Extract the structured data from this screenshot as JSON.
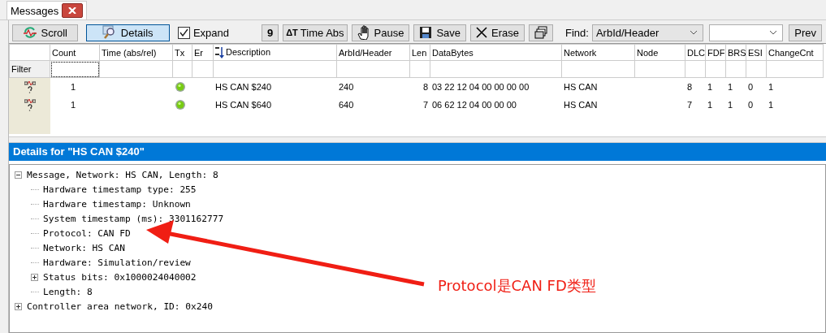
{
  "tab": {
    "title": "Messages",
    "selected": true
  },
  "toolbar": [
    {
      "kind": "button",
      "label": "Scroll",
      "pressed": false
    },
    {
      "kind": "button",
      "label": "Details",
      "pressed": true
    },
    {
      "kind": "checkbox",
      "label": "Expand",
      "checked": true
    },
    {
      "kind": "button",
      "label": "9",
      "pressed": false
    },
    {
      "kind": "button",
      "glyph": "ΔT",
      "label": "Time Abs",
      "pressed": false
    },
    {
      "kind": "button",
      "label": "Pause",
      "pressed": false
    },
    {
      "kind": "button",
      "label": "Save",
      "pressed": false
    },
    {
      "kind": "button",
      "label": "Erase",
      "pressed": false
    },
    {
      "kind": "button",
      "pressed": false
    },
    {
      "kind": "label",
      "label": "Find:"
    },
    {
      "kind": "dropdown",
      "value": "ArbId/Header"
    },
    {
      "kind": "dropdown"
    },
    {
      "kind": "button",
      "label": "Prev",
      "pressed": false
    }
  ],
  "grid": {
    "columns": [
      {},
      {
        "label": "Count"
      },
      {
        "label": "Time (abs/rel)"
      },
      {
        "label": "Tx"
      },
      {
        "label": "Er"
      },
      {
        "label": "Description",
        "sorted": true
      },
      {
        "label": "ArbId/Header"
      },
      {
        "label": "Len"
      },
      {
        "label": "DataBytes"
      },
      {
        "label": "Network"
      },
      {
        "label": "Node"
      },
      {
        "label": "DLC"
      },
      {
        "label": "FDF"
      },
      {
        "label": "BRS"
      },
      {
        "label": "ESI"
      },
      {
        "label": "ChangeCnt"
      }
    ],
    "filter_label": "Filter",
    "rows": [
      {
        "count": "1",
        "tx": true,
        "description": "HS CAN $240",
        "arbid": "240",
        "len": "8",
        "data": "03 22 12 04 00 00 00 00",
        "network": "HS CAN",
        "dlc": "8",
        "fdf": "1",
        "brs": "1",
        "esi": "0",
        "changecnt": "1"
      },
      {
        "count": "1",
        "tx": true,
        "description": "HS CAN $640",
        "arbid": "640",
        "len": "7",
        "data": "06 62 12 04 00 00 00",
        "network": "HS CAN",
        "dlc": "7",
        "fdf": "1",
        "brs": "1",
        "esi": "0",
        "changecnt": "1"
      }
    ]
  },
  "details": {
    "title": "Details for \"HS CAN $240\"",
    "tree": [
      {
        "text": "Message, Network: HS CAN, Length: 8",
        "expanded": true,
        "children": [
          {
            "text": "Hardware timestamp type: 255"
          },
          {
            "text": "Hardware timestamp: Unknown"
          },
          {
            "text": "System timestamp (ms): 3301162777"
          },
          {
            "text": "Protocol: CAN FD"
          },
          {
            "text": "Network: HS CAN"
          },
          {
            "text": "Hardware: Simulation/review"
          },
          {
            "text": "Status bits: 0x1000024040002",
            "expanded": false
          },
          {
            "text": "Length: 8"
          }
        ]
      },
      {
        "text": "Controller area network, ID: 0x240",
        "expanded": false
      }
    ]
  },
  "annotation": {
    "text": "Protocol是CAN FD类型"
  }
}
